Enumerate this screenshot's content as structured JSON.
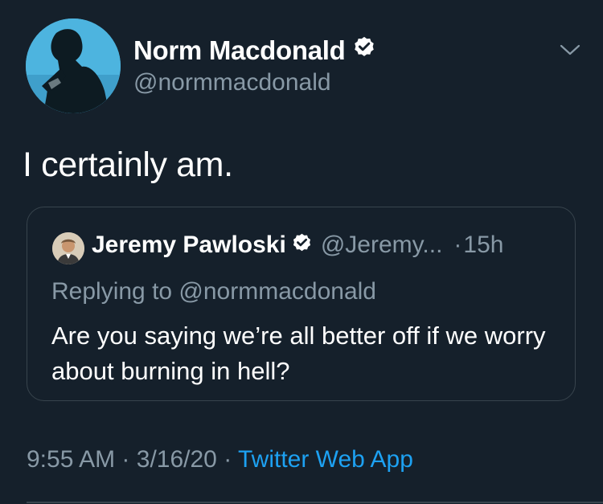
{
  "author": {
    "name": "Norm Macdonald",
    "handle": "@normmacdonald",
    "verified": true
  },
  "tweet": {
    "text": "I certainly am."
  },
  "quoted_tweet": {
    "author_name": "Jeremy Pawloski",
    "author_handle": "@Jeremy...",
    "separator": "·",
    "time": "15h",
    "replying_to": "Replying to @normmacdonald",
    "body": "Are you saying we’re all better off if we worry about burning in hell?"
  },
  "meta": {
    "time": "9:55 AM",
    "separator_1": "·",
    "date": "3/16/20",
    "separator_2": "·",
    "source": "Twitter Web App"
  },
  "colors": {
    "background": "#15202b",
    "text_primary": "#ffffff",
    "text_secondary": "#8899a6",
    "accent": "#1da1f2",
    "border": "#38444d"
  },
  "icons": {
    "author_verified": "verified-badge-icon",
    "options": "chevron-down-icon",
    "quoted_verified": "verified-badge-icon"
  }
}
